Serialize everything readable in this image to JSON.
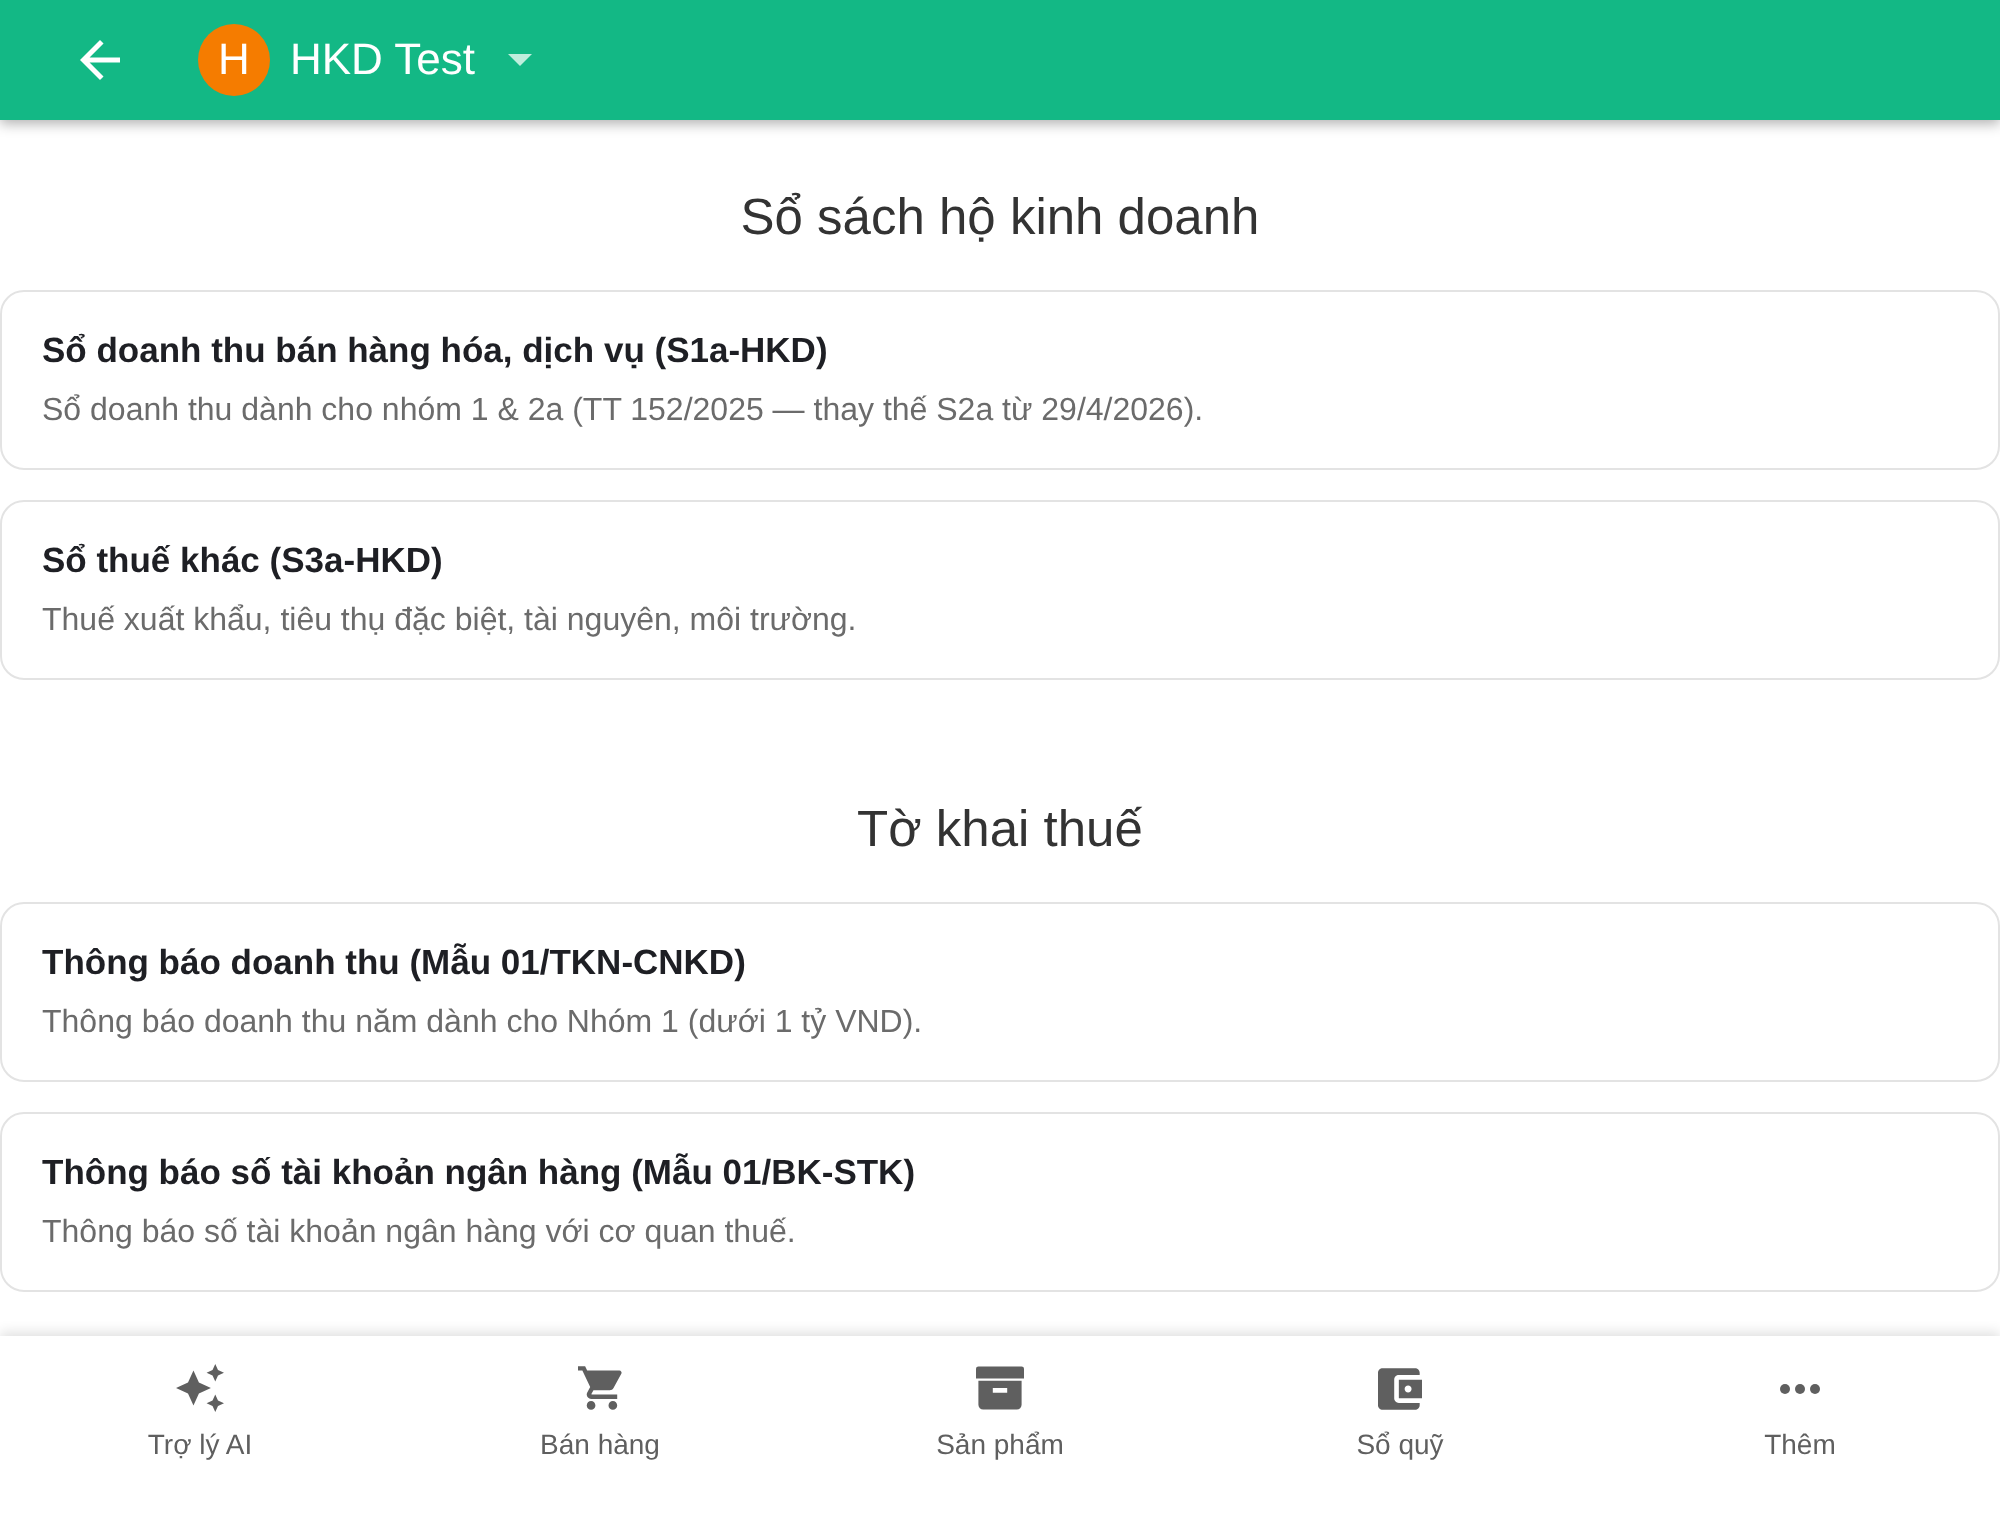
{
  "app_bar": {
    "avatar_letter": "H",
    "business_name": "HKD Test"
  },
  "sections": [
    {
      "title": "Sổ sách hộ kinh doanh",
      "items": [
        {
          "title": "Sổ doanh thu bán hàng hóa, dịch vụ (S1a-HKD)",
          "description": "Sổ doanh thu dành cho nhóm 1 & 2a (TT 152/2025 — thay thế S2a từ 29/4/2026)."
        },
        {
          "title": "Sổ thuế khác (S3a-HKD)",
          "description": "Thuế xuất khẩu, tiêu thụ đặc biệt, tài nguyên, môi trường."
        }
      ]
    },
    {
      "title": "Tờ khai thuế",
      "items": [
        {
          "title": "Thông báo doanh thu (Mẫu 01/TKN-CNKD)",
          "description": "Thông báo doanh thu năm dành cho Nhóm 1 (dưới 1 tỷ VND)."
        },
        {
          "title": "Thông báo số tài khoản ngân hàng (Mẫu 01/BK-STK)",
          "description": "Thông báo số tài khoản ngân hàng với cơ quan thuế."
        }
      ]
    }
  ],
  "bottom_nav": [
    {
      "label": "Trợ lý AI",
      "selected": false
    },
    {
      "label": "Bán hàng",
      "selected": false
    },
    {
      "label": "Sản phẩm",
      "selected": false
    },
    {
      "label": "Sổ quỹ",
      "selected": false
    },
    {
      "label": "Thêm",
      "selected": false
    }
  ]
}
